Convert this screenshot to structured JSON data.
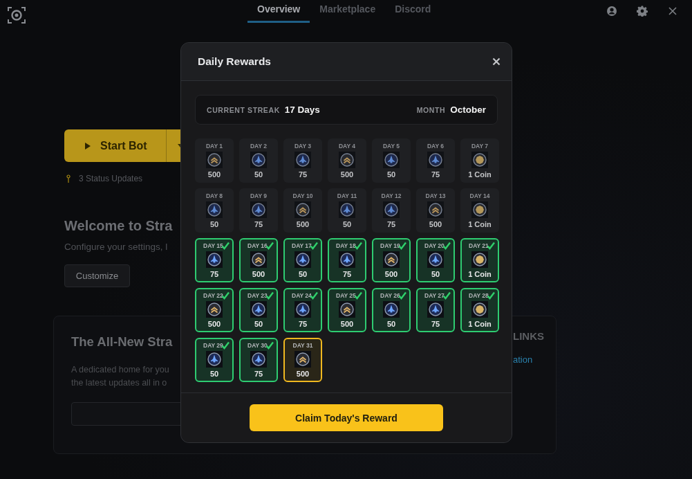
{
  "topbar": {
    "tabs": [
      {
        "label": "Overview",
        "selected": true
      },
      {
        "label": "Marketplace",
        "selected": false
      },
      {
        "label": "Discord",
        "selected": false
      }
    ]
  },
  "main": {
    "start_button": "Start Bot",
    "status": "3 Status Updates",
    "welcome_title": "Welcome to Stra",
    "welcome_text": "Configure your settings, l",
    "customize_button": "Customize",
    "card": {
      "title": "The All-New Stra",
      "text_lines": [
        "A dedicated home for you",
        "the latest updates all in o"
      ],
      "links_heading": "LINKS",
      "link": "ation"
    }
  },
  "modal": {
    "title": "Daily Rewards",
    "streak_label": "CURRENT STREAK",
    "streak_value": "17 Days",
    "month_label": "MONTH",
    "month_value": "October",
    "days": [
      {
        "label": "DAY 1",
        "reward": "500",
        "kind": "chevron",
        "claimed": false,
        "selected": false
      },
      {
        "label": "DAY 2",
        "reward": "50",
        "kind": "ship",
        "claimed": false,
        "selected": false
      },
      {
        "label": "DAY 3",
        "reward": "75",
        "kind": "ship",
        "claimed": false,
        "selected": false
      },
      {
        "label": "DAY 4",
        "reward": "500",
        "kind": "chevron",
        "claimed": false,
        "selected": false
      },
      {
        "label": "DAY 5",
        "reward": "50",
        "kind": "ship",
        "claimed": false,
        "selected": false
      },
      {
        "label": "DAY 6",
        "reward": "75",
        "kind": "ship",
        "claimed": false,
        "selected": false
      },
      {
        "label": "DAY 7",
        "reward": "1 Coin",
        "kind": "coin",
        "claimed": false,
        "selected": false
      },
      {
        "label": "DAY 8",
        "reward": "50",
        "kind": "ship",
        "claimed": false,
        "selected": false
      },
      {
        "label": "DAY 9",
        "reward": "75",
        "kind": "ship",
        "claimed": false,
        "selected": false
      },
      {
        "label": "DAY 10",
        "reward": "500",
        "kind": "chevron",
        "claimed": false,
        "selected": false
      },
      {
        "label": "DAY 11",
        "reward": "50",
        "kind": "ship",
        "claimed": false,
        "selected": false
      },
      {
        "label": "DAY 12",
        "reward": "75",
        "kind": "ship",
        "claimed": false,
        "selected": false
      },
      {
        "label": "DAY 13",
        "reward": "500",
        "kind": "chevron",
        "claimed": false,
        "selected": false
      },
      {
        "label": "DAY 14",
        "reward": "1 Coin",
        "kind": "coin",
        "claimed": false,
        "selected": false
      },
      {
        "label": "DAY 15",
        "reward": "75",
        "kind": "ship",
        "claimed": true,
        "selected": false
      },
      {
        "label": "DAY 16",
        "reward": "500",
        "kind": "chevron",
        "claimed": true,
        "selected": false
      },
      {
        "label": "DAY 17",
        "reward": "50",
        "kind": "ship",
        "claimed": true,
        "selected": false
      },
      {
        "label": "DAY 18",
        "reward": "75",
        "kind": "ship",
        "claimed": true,
        "selected": false
      },
      {
        "label": "DAY 19",
        "reward": "500",
        "kind": "chevron",
        "claimed": true,
        "selected": false
      },
      {
        "label": "DAY 20",
        "reward": "50",
        "kind": "ship",
        "claimed": true,
        "selected": false
      },
      {
        "label": "DAY 21",
        "reward": "1 Coin",
        "kind": "coin",
        "claimed": true,
        "selected": false
      },
      {
        "label": "DAY 22",
        "reward": "500",
        "kind": "chevron",
        "claimed": true,
        "selected": false
      },
      {
        "label": "DAY 23",
        "reward": "50",
        "kind": "ship",
        "claimed": true,
        "selected": false
      },
      {
        "label": "DAY 24",
        "reward": "75",
        "kind": "ship",
        "claimed": true,
        "selected": false
      },
      {
        "label": "DAY 25",
        "reward": "500",
        "kind": "chevron",
        "claimed": true,
        "selected": false
      },
      {
        "label": "DAY 26",
        "reward": "50",
        "kind": "ship",
        "claimed": true,
        "selected": false
      },
      {
        "label": "DAY 27",
        "reward": "75",
        "kind": "ship",
        "claimed": true,
        "selected": false
      },
      {
        "label": "DAY 28",
        "reward": "1 Coin",
        "kind": "coin",
        "claimed": true,
        "selected": false
      },
      {
        "label": "DAY 29",
        "reward": "50",
        "kind": "ship",
        "claimed": true,
        "selected": false
      },
      {
        "label": "DAY 30",
        "reward": "75",
        "kind": "ship",
        "claimed": true,
        "selected": false
      },
      {
        "label": "DAY 31",
        "reward": "500",
        "kind": "chevron",
        "claimed": false,
        "selected": true
      }
    ],
    "claim_button": "Claim Today's Reward"
  }
}
